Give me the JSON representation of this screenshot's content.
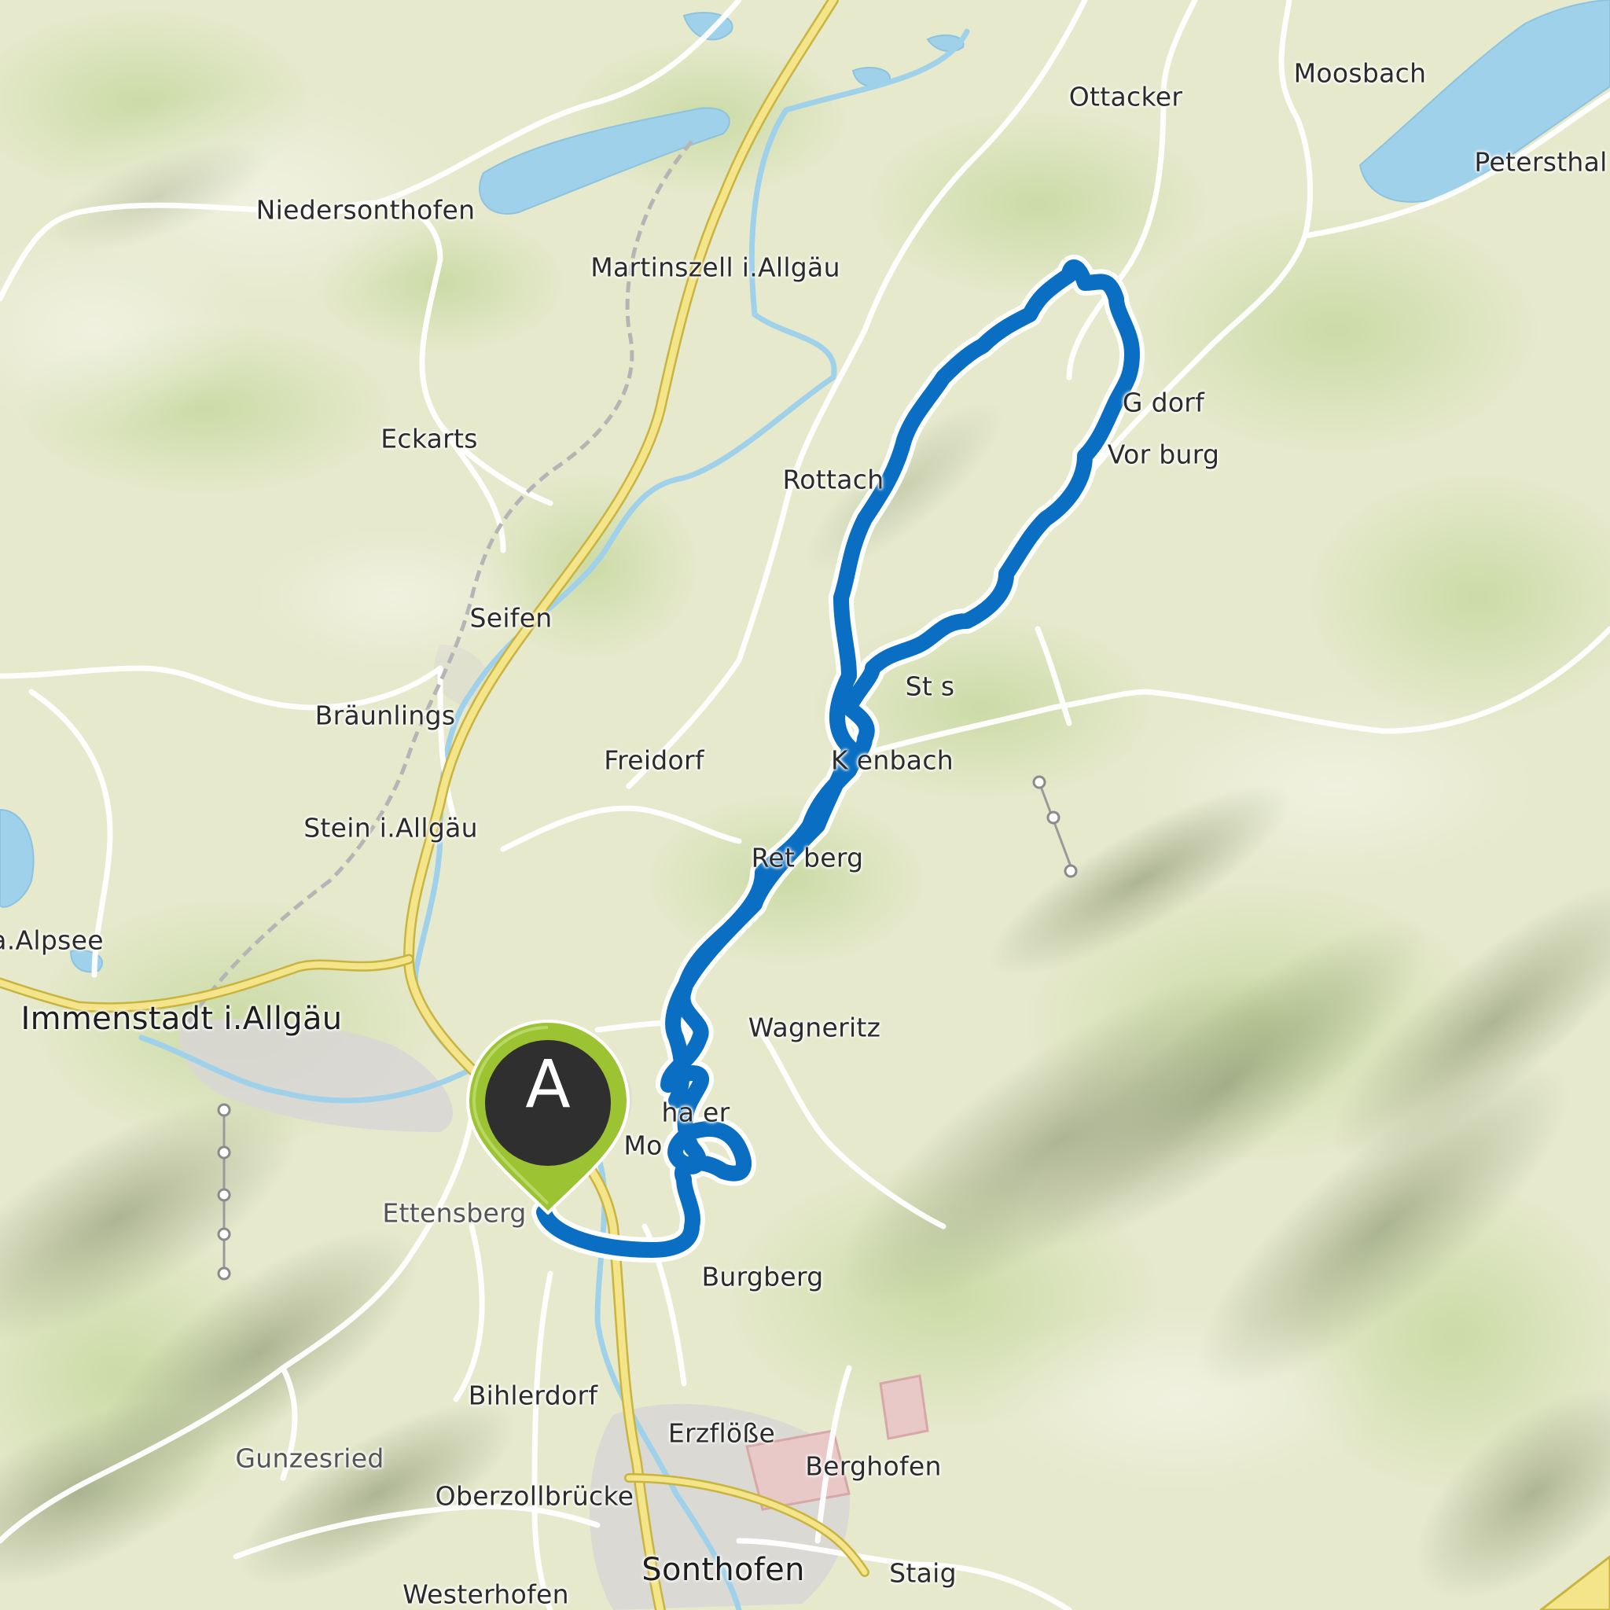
{
  "map": {
    "route_color": "#0a6fc2",
    "water_color": "#9fd1ea",
    "highway_color": "#f4e58a",
    "marker_color": "#9cc332"
  },
  "places": {
    "niedersonthofen": "Niedersonthofen",
    "martinszell": "Martinszell i.Allgäu",
    "ottacker": "Ottacker",
    "moosbach": "Moosbach",
    "petersthal": "Petersthal",
    "eckarts": "Eckarts",
    "rottach": "Rottach",
    "g_dorf": "G    dorf",
    "vorderburg": "Vor       burg",
    "seifen": "Seifen",
    "braunlings": "Bräunlings",
    "st_label": "St       s",
    "freidorf": "Freidorf",
    "k_enbach": "K          enbach",
    "stein": "Stein i.Allgäu",
    "retten_berg": "Ret      berg",
    "alpsee": "a.Alpsee",
    "immenstadt": "Immenstadt i.Allgäu",
    "wagneritz": "Wagneritz",
    "ettensberg": "Ettensberg",
    "ha_er": "ha       er",
    "mo": "Mo",
    "burgberg": "Burgberg",
    "bihlerdorf": "Bihlerdorf",
    "erzfloesse": "Erzflöße",
    "gunzesried": "Gunzesried",
    "berghofen": "Berghofen",
    "oberzollbruecke": "Oberzollbrücke",
    "sonthofen": "Sonthofen",
    "staig": "Staig",
    "westerhofen": "Westerhofen"
  },
  "marker": {
    "letter": "A"
  }
}
